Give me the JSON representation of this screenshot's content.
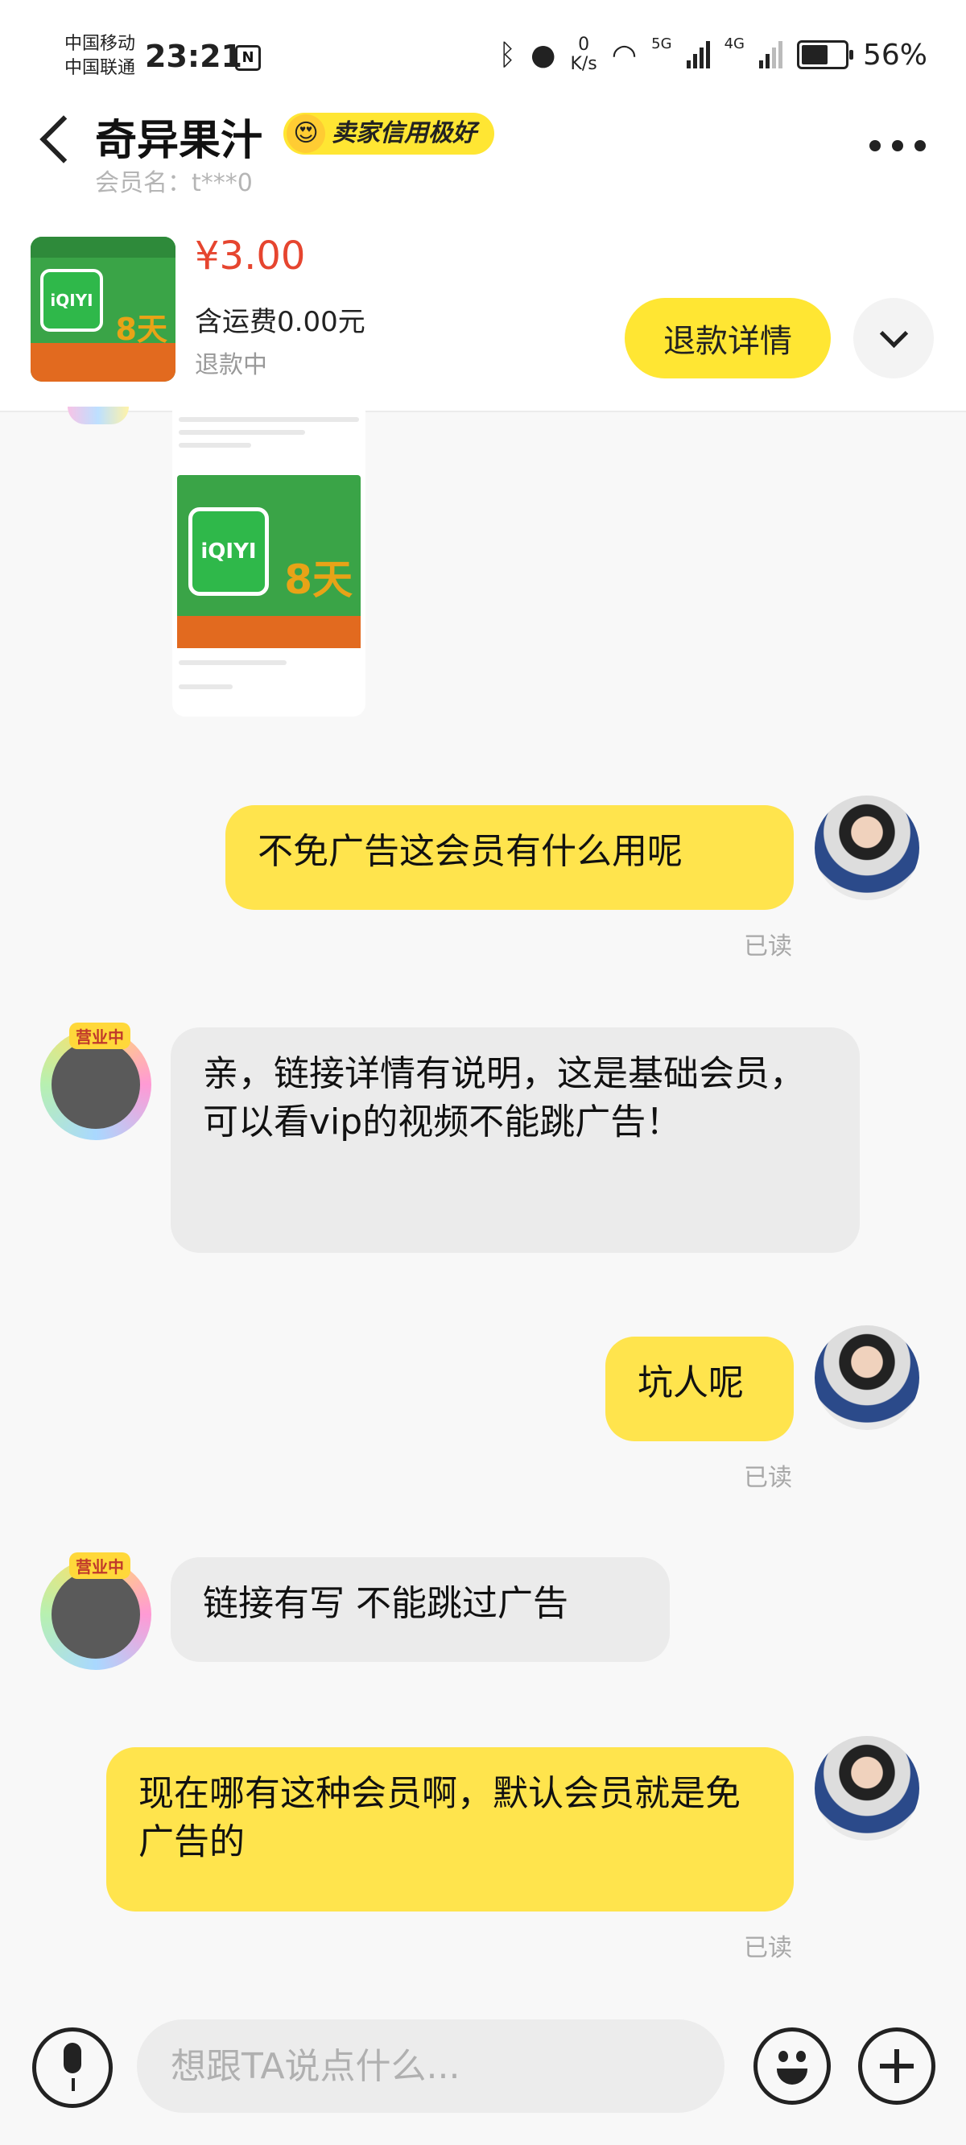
{
  "status_bar": {
    "carrier_1": "中国移动",
    "carrier_2": "中国联通",
    "time": "23:21",
    "net_speed_value": "0",
    "net_speed_unit": "K/s",
    "net_5g": "5G",
    "net_4g": "4G",
    "battery": "56%"
  },
  "header": {
    "shop_name": "奇异果汁",
    "badge": "卖家信用极好",
    "member": "会员名：t***0"
  },
  "product": {
    "price": "¥3.00",
    "shipping": "含运费0.00元",
    "status": "退款中",
    "refund_button": "退款详情",
    "thumb_brand": "iQIYI",
    "thumb_days": "8天"
  },
  "messages": [
    {
      "from": "me",
      "text": "不免广告这会员有什么用呢",
      "read": "已读"
    },
    {
      "from": "seller",
      "text": "亲，链接详情有说明，这是基础会员，可以看vip的视频不能跳广告！",
      "tag": "营业中"
    },
    {
      "from": "me",
      "text": "坑人呢",
      "read": "已读"
    },
    {
      "from": "seller",
      "text": "链接有写 不能跳过广告",
      "tag": "营业中"
    },
    {
      "from": "me",
      "text": "现在哪有这种会员啊，默认会员就是免广告的",
      "read": "已读"
    }
  ],
  "input": {
    "placeholder": "想跟TA说点什么..."
  }
}
